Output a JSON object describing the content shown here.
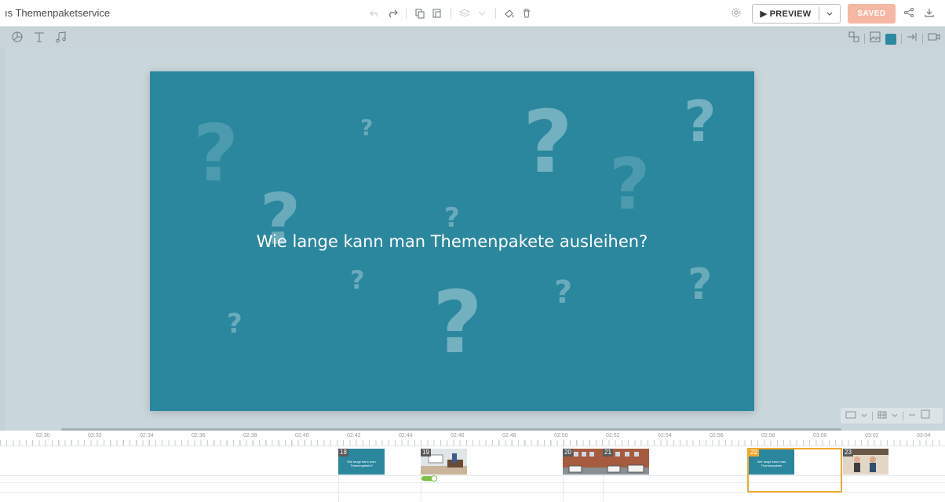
{
  "header": {
    "title": "ıs Themenpaketservice",
    "preview_label": "▶ PREVIEW",
    "saved_label": "SAVED"
  },
  "slide": {
    "text": "Wie lange kann man Themenpakete ausleihen?",
    "background_color": "#2a879e"
  },
  "timeline": {
    "ruler_labels": [
      "02:30",
      "02:32",
      "02:34",
      "02:36",
      "02:38",
      "02:40",
      "02:42",
      "02:44",
      "02:46",
      "02:48",
      "02:50",
      "02:52",
      "02:54",
      "02:56",
      "02:58",
      "03:00",
      "03:02",
      "03:04"
    ],
    "scenes": [
      {
        "number": "18",
        "caption": "Wie lange kann man Themenpakete?"
      },
      {
        "number": "19",
        "caption": ""
      },
      {
        "number": "20",
        "caption": ""
      },
      {
        "number": "21",
        "caption": ""
      },
      {
        "number": "22",
        "caption": "Wie lange kann man Themenpakete"
      },
      {
        "number": "23",
        "caption": ""
      }
    ]
  },
  "colors": {
    "accent_saved": "#f6b8a4",
    "selection": "#f0a830",
    "slide": "#2a879e"
  },
  "icons": {
    "toolbar": [
      "undo-icon",
      "redo-icon",
      "copy-icon",
      "paste-icon",
      "layers-icon",
      "paint-icon",
      "trash-icon"
    ],
    "insert": [
      "chart-icon",
      "text-icon",
      "music-icon"
    ]
  }
}
